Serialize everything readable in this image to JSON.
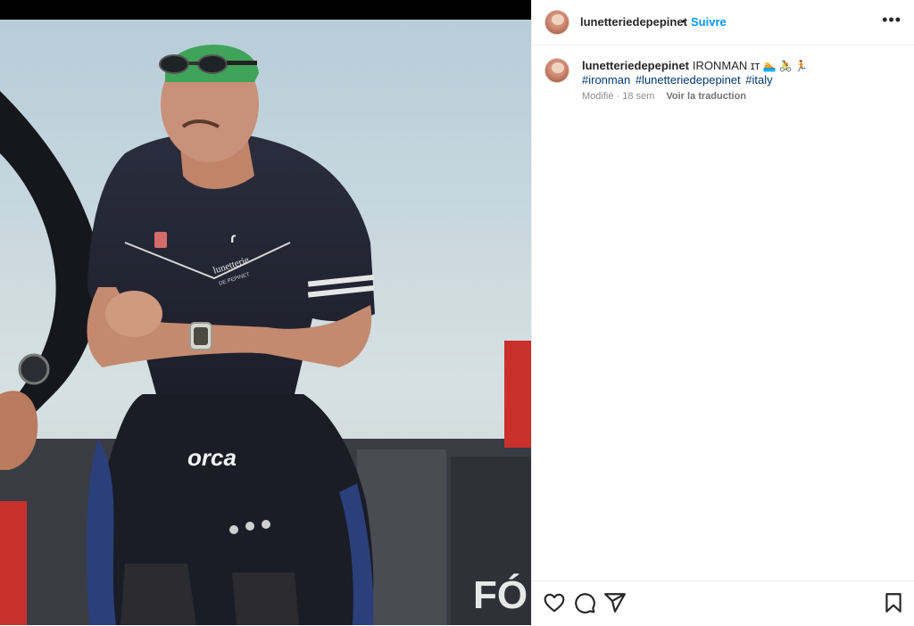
{
  "post": {
    "author": "lunetteriedepepinet",
    "separator": "•",
    "follow_label": "Suivre",
    "more_label": "•••"
  },
  "caption": {
    "author": "lunetteriedepepinet",
    "text": "IRONMAN ɪᴛ",
    "emojis": [
      "🏊",
      "🚴",
      "🏃"
    ],
    "hashtags": [
      "#ironman",
      "#lunetteriedepepinet",
      "#italy"
    ],
    "modified_label": "Modifié · 18 sem",
    "translate_label": "Voir la traduction"
  },
  "photo": {
    "suit_brand": "orca",
    "chest_print": "lunetterie",
    "chest_sub": "DE PEPINET"
  },
  "actions": {
    "icons": [
      "heart-icon",
      "comment-icon",
      "share-icon",
      "bookmark-icon"
    ]
  },
  "colors": {
    "follow": "#0095f6",
    "hashtag": "#00376b",
    "muted": "#8e8e8e"
  }
}
